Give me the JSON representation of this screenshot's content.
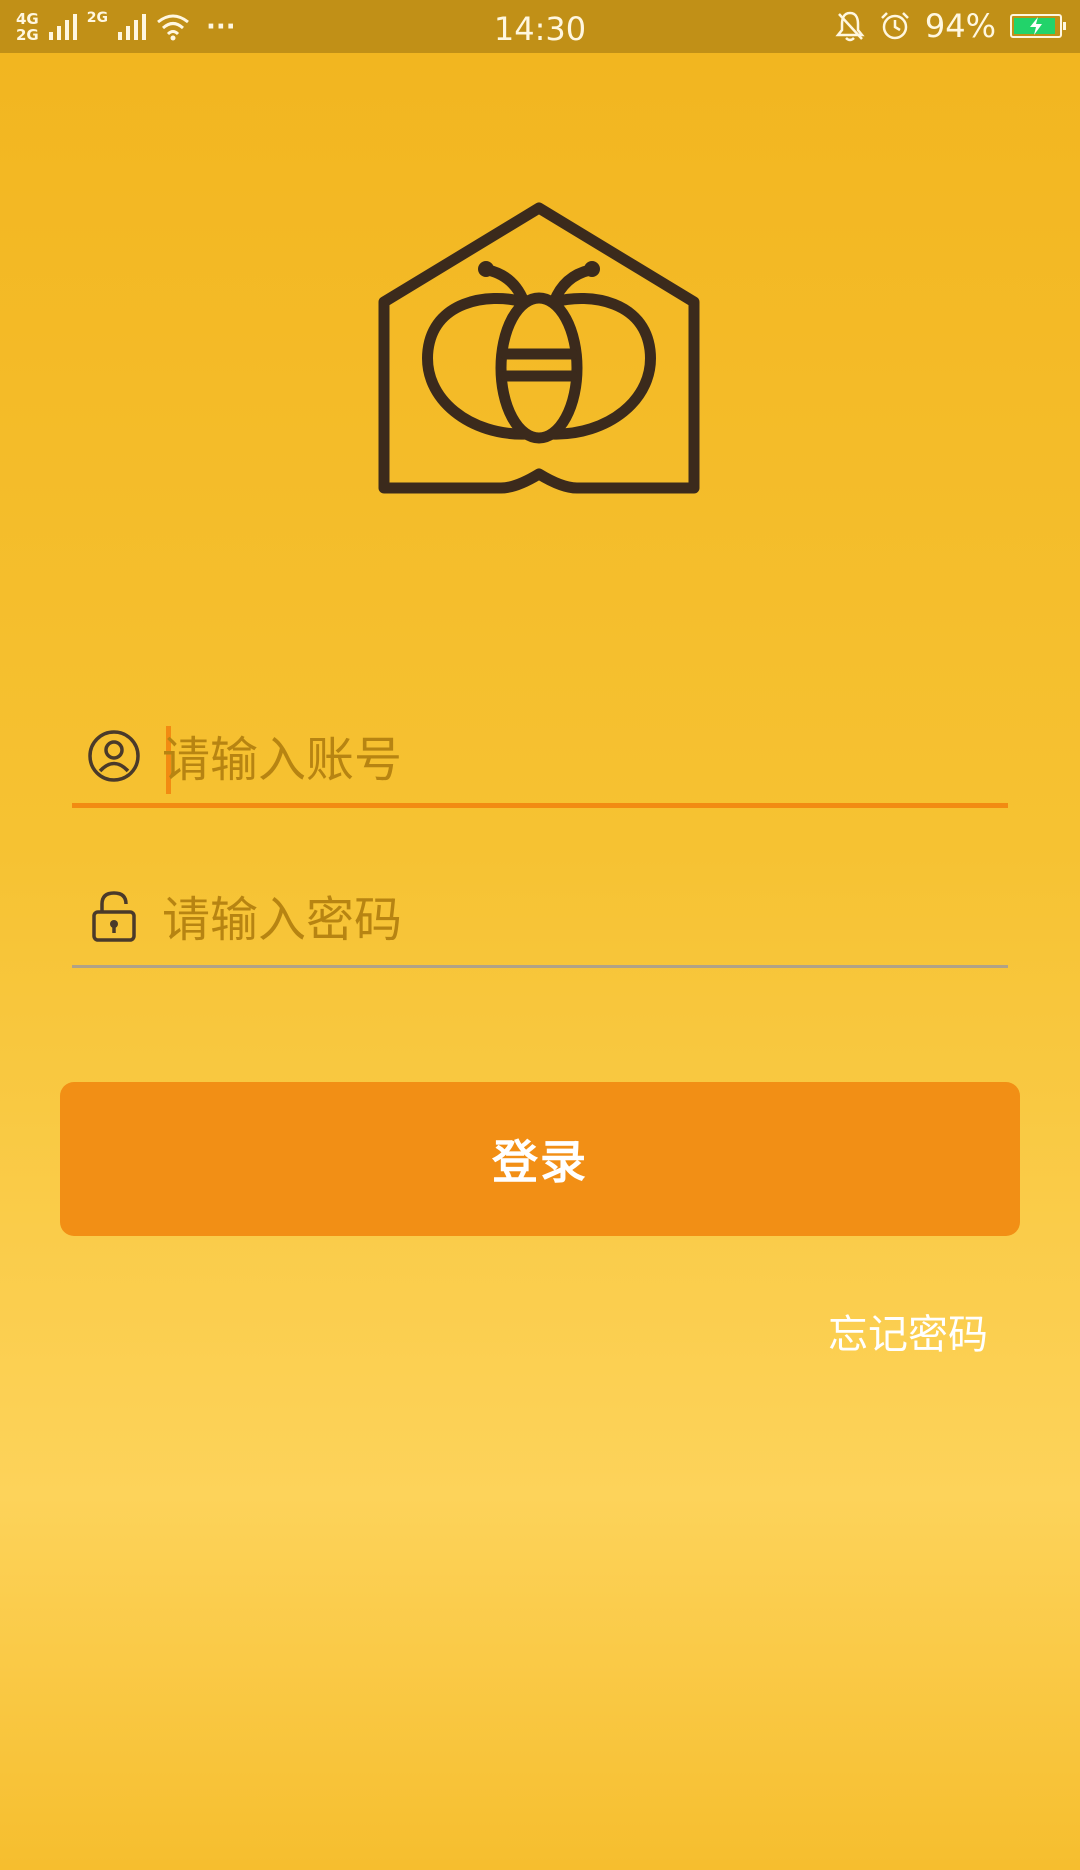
{
  "status_bar": {
    "network_top": "4G",
    "network_bottom": "2G",
    "network2": "2G",
    "more": "···",
    "time": "14:30",
    "battery_percent": "94%",
    "battery_level": 0.94,
    "battery_color": "#22d36a",
    "icons": [
      "signal-icon",
      "wifi-icon",
      "mute-bell-icon",
      "alarm-clock-icon",
      "battery-charging-icon"
    ]
  },
  "logo": {
    "icon": "bee-house-logo"
  },
  "login_form": {
    "account": {
      "placeholder": "请输入账号",
      "value": "",
      "icon": "user-icon"
    },
    "password": {
      "placeholder": "请输入密码",
      "value": "",
      "icon": "lock-icon"
    },
    "submit_label": "登录",
    "forgot_label": "忘记密码"
  },
  "colors": {
    "primary": "#f28f15",
    "background_top": "#f2b51f",
    "background_mid": "#fdd35a",
    "logo_stroke": "#3b2a1c",
    "status_bar": "#c19017"
  }
}
